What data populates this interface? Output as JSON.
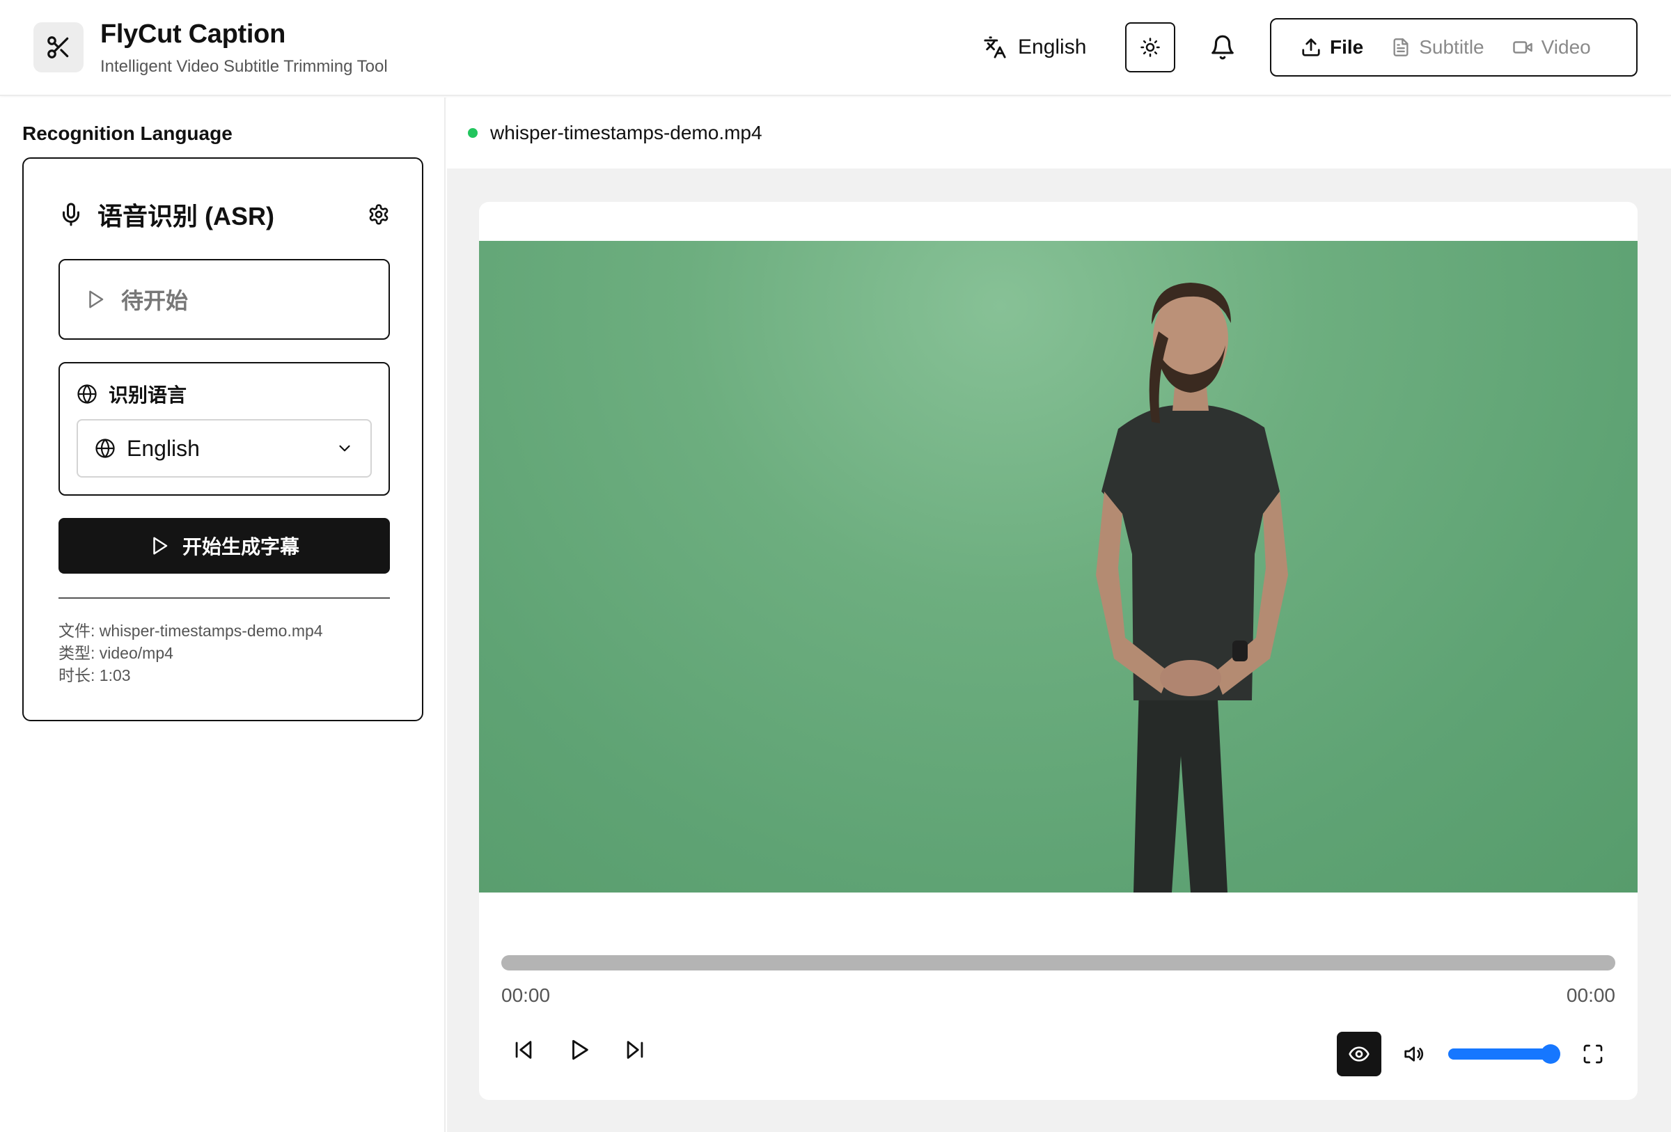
{
  "header": {
    "app_title": "FlyCut Caption",
    "app_subtitle": "Intelligent Video Subtitle Trimming Tool",
    "language_label": "English",
    "modes": [
      {
        "label": "File",
        "active": true
      },
      {
        "label": "Subtitle",
        "active": false
      },
      {
        "label": "Video",
        "active": false
      }
    ]
  },
  "sidebar": {
    "section_title": "Recognition Language",
    "asr": {
      "title": "语音识别 (ASR)",
      "status": "待开始",
      "language_label": "识别语言",
      "language_value": "English",
      "start_button": "开始生成字幕",
      "file_info": {
        "file": "文件: whisper-timestamps-demo.mp4",
        "type": "类型: video/mp4",
        "duration": "时长: 1:03"
      }
    }
  },
  "main": {
    "file_name": "whisper-timestamps-demo.mp4",
    "file_status_color": "#22c55e",
    "player": {
      "current_time": "00:00",
      "total_time": "00:00",
      "progress_percent": 0,
      "volume_percent": 92
    }
  },
  "colors": {
    "accent": "#1677ff",
    "primary_button": "#141414"
  }
}
